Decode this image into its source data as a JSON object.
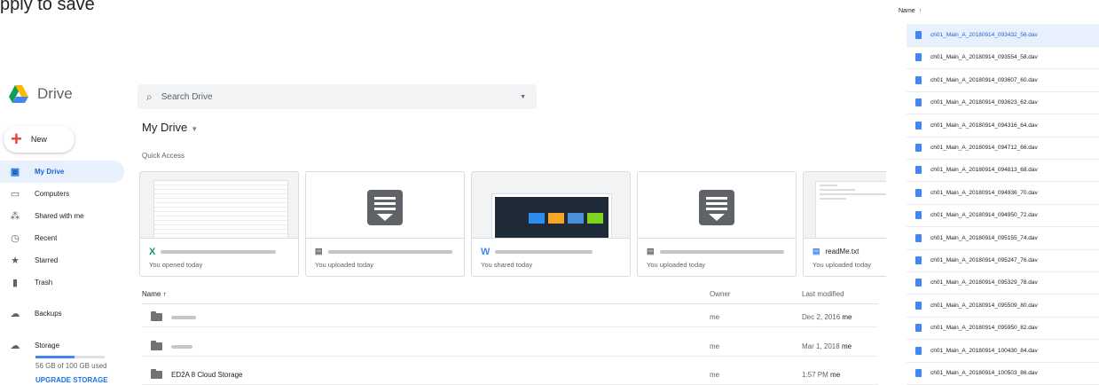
{
  "overlay_text": "pply to save",
  "app": {
    "name": "Drive"
  },
  "new_button": {
    "label": "New"
  },
  "nav": [
    {
      "label": "My Drive",
      "icon": "drive-icon",
      "glyph": "▣",
      "active": true
    },
    {
      "label": "Computers",
      "icon": "computer-icon",
      "glyph": "▭"
    },
    {
      "label": "Shared with me",
      "icon": "people-icon",
      "glyph": "⁂"
    },
    {
      "label": "Recent",
      "icon": "clock-icon",
      "glyph": "◷"
    },
    {
      "label": "Starred",
      "icon": "star-icon",
      "glyph": "★"
    },
    {
      "label": "Trash",
      "icon": "trash-icon",
      "glyph": "▮"
    },
    {
      "label": "Backups",
      "icon": "cloud-icon",
      "glyph": "☁"
    },
    {
      "label": "Storage",
      "icon": "cloud-outline-icon",
      "glyph": "☁"
    }
  ],
  "storage": {
    "text": "56 GB of 100 GB used",
    "used_fraction": 0.56,
    "upgrade_label": "UPGRADE STORAGE"
  },
  "search": {
    "placeholder": "Search Drive"
  },
  "breadcrumb": {
    "title": "My Drive"
  },
  "quick_access": {
    "label": "Quick Access",
    "cards": [
      {
        "type_letter": "X",
        "type_color": "#0f9d58",
        "name": "",
        "subtitle": "You opened today"
      },
      {
        "type_letter": "▤",
        "type_color": "#5f6368",
        "name": "",
        "subtitle": "You uploaded today"
      },
      {
        "type_letter": "W",
        "type_color": "#4285f4",
        "name": "",
        "subtitle": "You shared today"
      },
      {
        "type_letter": "▤",
        "type_color": "#5f6368",
        "name": "",
        "subtitle": "You uploaded today"
      },
      {
        "type_letter": "▤",
        "type_color": "#4285f4",
        "name": "readMe.txt",
        "subtitle": "You uploaded today"
      }
    ]
  },
  "file_list": {
    "headers": {
      "name": "Name ↑",
      "owner": "Owner",
      "modified": "Last modified"
    },
    "rows": [
      {
        "name": "",
        "owner": "me",
        "modified": "Dec 2, 2016",
        "by": "me"
      },
      {
        "name": "",
        "owner": "me",
        "modified": "Mar 1, 2018",
        "by": "me"
      },
      {
        "name": "ED2A 8 Cloud Storage",
        "owner": "me",
        "modified": "1:57 PM",
        "by": "me"
      }
    ]
  },
  "right_panel": {
    "header": "Name",
    "sort_arrow": "↑",
    "files": [
      "ch01_Main_A_20180914_093432_56.dav",
      "ch01_Main_A_20180914_093554_58.dav",
      "ch01_Main_A_20180914_093607_60.dav",
      "ch01_Main_A_20180914_093623_62.dav",
      "ch01_Main_A_20180914_094316_64.dav",
      "ch01_Main_A_20180914_094712_66.dav",
      "ch01_Main_A_20180914_094813_68.dav",
      "ch01_Main_A_20180914_094936_70.dav",
      "ch01_Main_A_20180914_094950_72.dav",
      "ch01_Main_A_20180914_095155_74.dav",
      "ch01_Main_A_20180914_095247_76.dav",
      "ch01_Main_A_20180914_095329_78.dav",
      "ch01_Main_A_20180914_095509_80.dav",
      "ch01_Main_A_20180914_095950_82.dav",
      "ch01_Main_A_20180914_100430_84.dav",
      "ch01_Main_A_20180914_100503_86.dav"
    ],
    "selected_index": 0
  },
  "colors": {
    "accent": "#1a73e8",
    "active_bg": "#e8f0fe",
    "border": "#dadce0"
  }
}
